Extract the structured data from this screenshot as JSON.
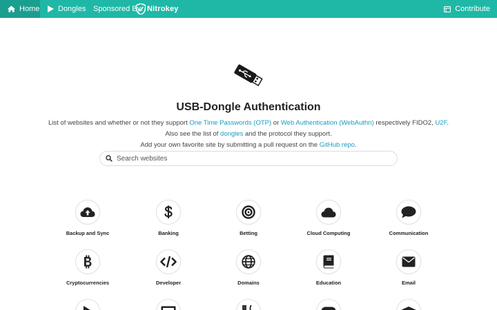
{
  "navbar": {
    "home": "Home",
    "dongles": "Dongles",
    "sponsor": "Sponsored By:",
    "sponsor_logo": "Nitrokey",
    "contribute": "Contribute"
  },
  "hero": {
    "title": "USB-Dongle Authentication",
    "line1_pre": "List of websites and whether or not they support ",
    "link_otp": "One Time Passwords (OTP)",
    "line1_mid": " or ",
    "link_webauthn": "Web Authentication (WebAuthn)",
    "line1_post": " respectively FIDO2, ",
    "link_u2f": "U2F",
    "line1_end": ".",
    "line2_pre": "Also see the list of ",
    "link_dongles": "dongles",
    "line2_post": " and the protocol they support.",
    "line3_pre": "Add your own favorite site by submitting a pull request on the ",
    "link_github": "GitHub repo",
    "line3_end": "."
  },
  "search": {
    "placeholder": "Search websites",
    "value": ""
  },
  "categories": [
    {
      "label": "Backup and Sync",
      "icon": "cloud-upload-icon"
    },
    {
      "label": "Banking",
      "icon": "dollar-icon"
    },
    {
      "label": "Betting",
      "icon": "target-icon"
    },
    {
      "label": "Cloud Computing",
      "icon": "cloud-icon"
    },
    {
      "label": "Communication",
      "icon": "chat-bubble-icon"
    },
    {
      "label": "Cryptocurrencies",
      "icon": "bitcoin-icon"
    },
    {
      "label": "Developer",
      "icon": "code-icon"
    },
    {
      "label": "Domains",
      "icon": "globe-icon"
    },
    {
      "label": "Education",
      "icon": "book-icon"
    },
    {
      "label": "Email",
      "icon": "envelope-icon"
    }
  ],
  "colors": {
    "navbar": "#1fb8a6",
    "navbar_active": "#1a9e90",
    "link": "#1a9bbf"
  }
}
